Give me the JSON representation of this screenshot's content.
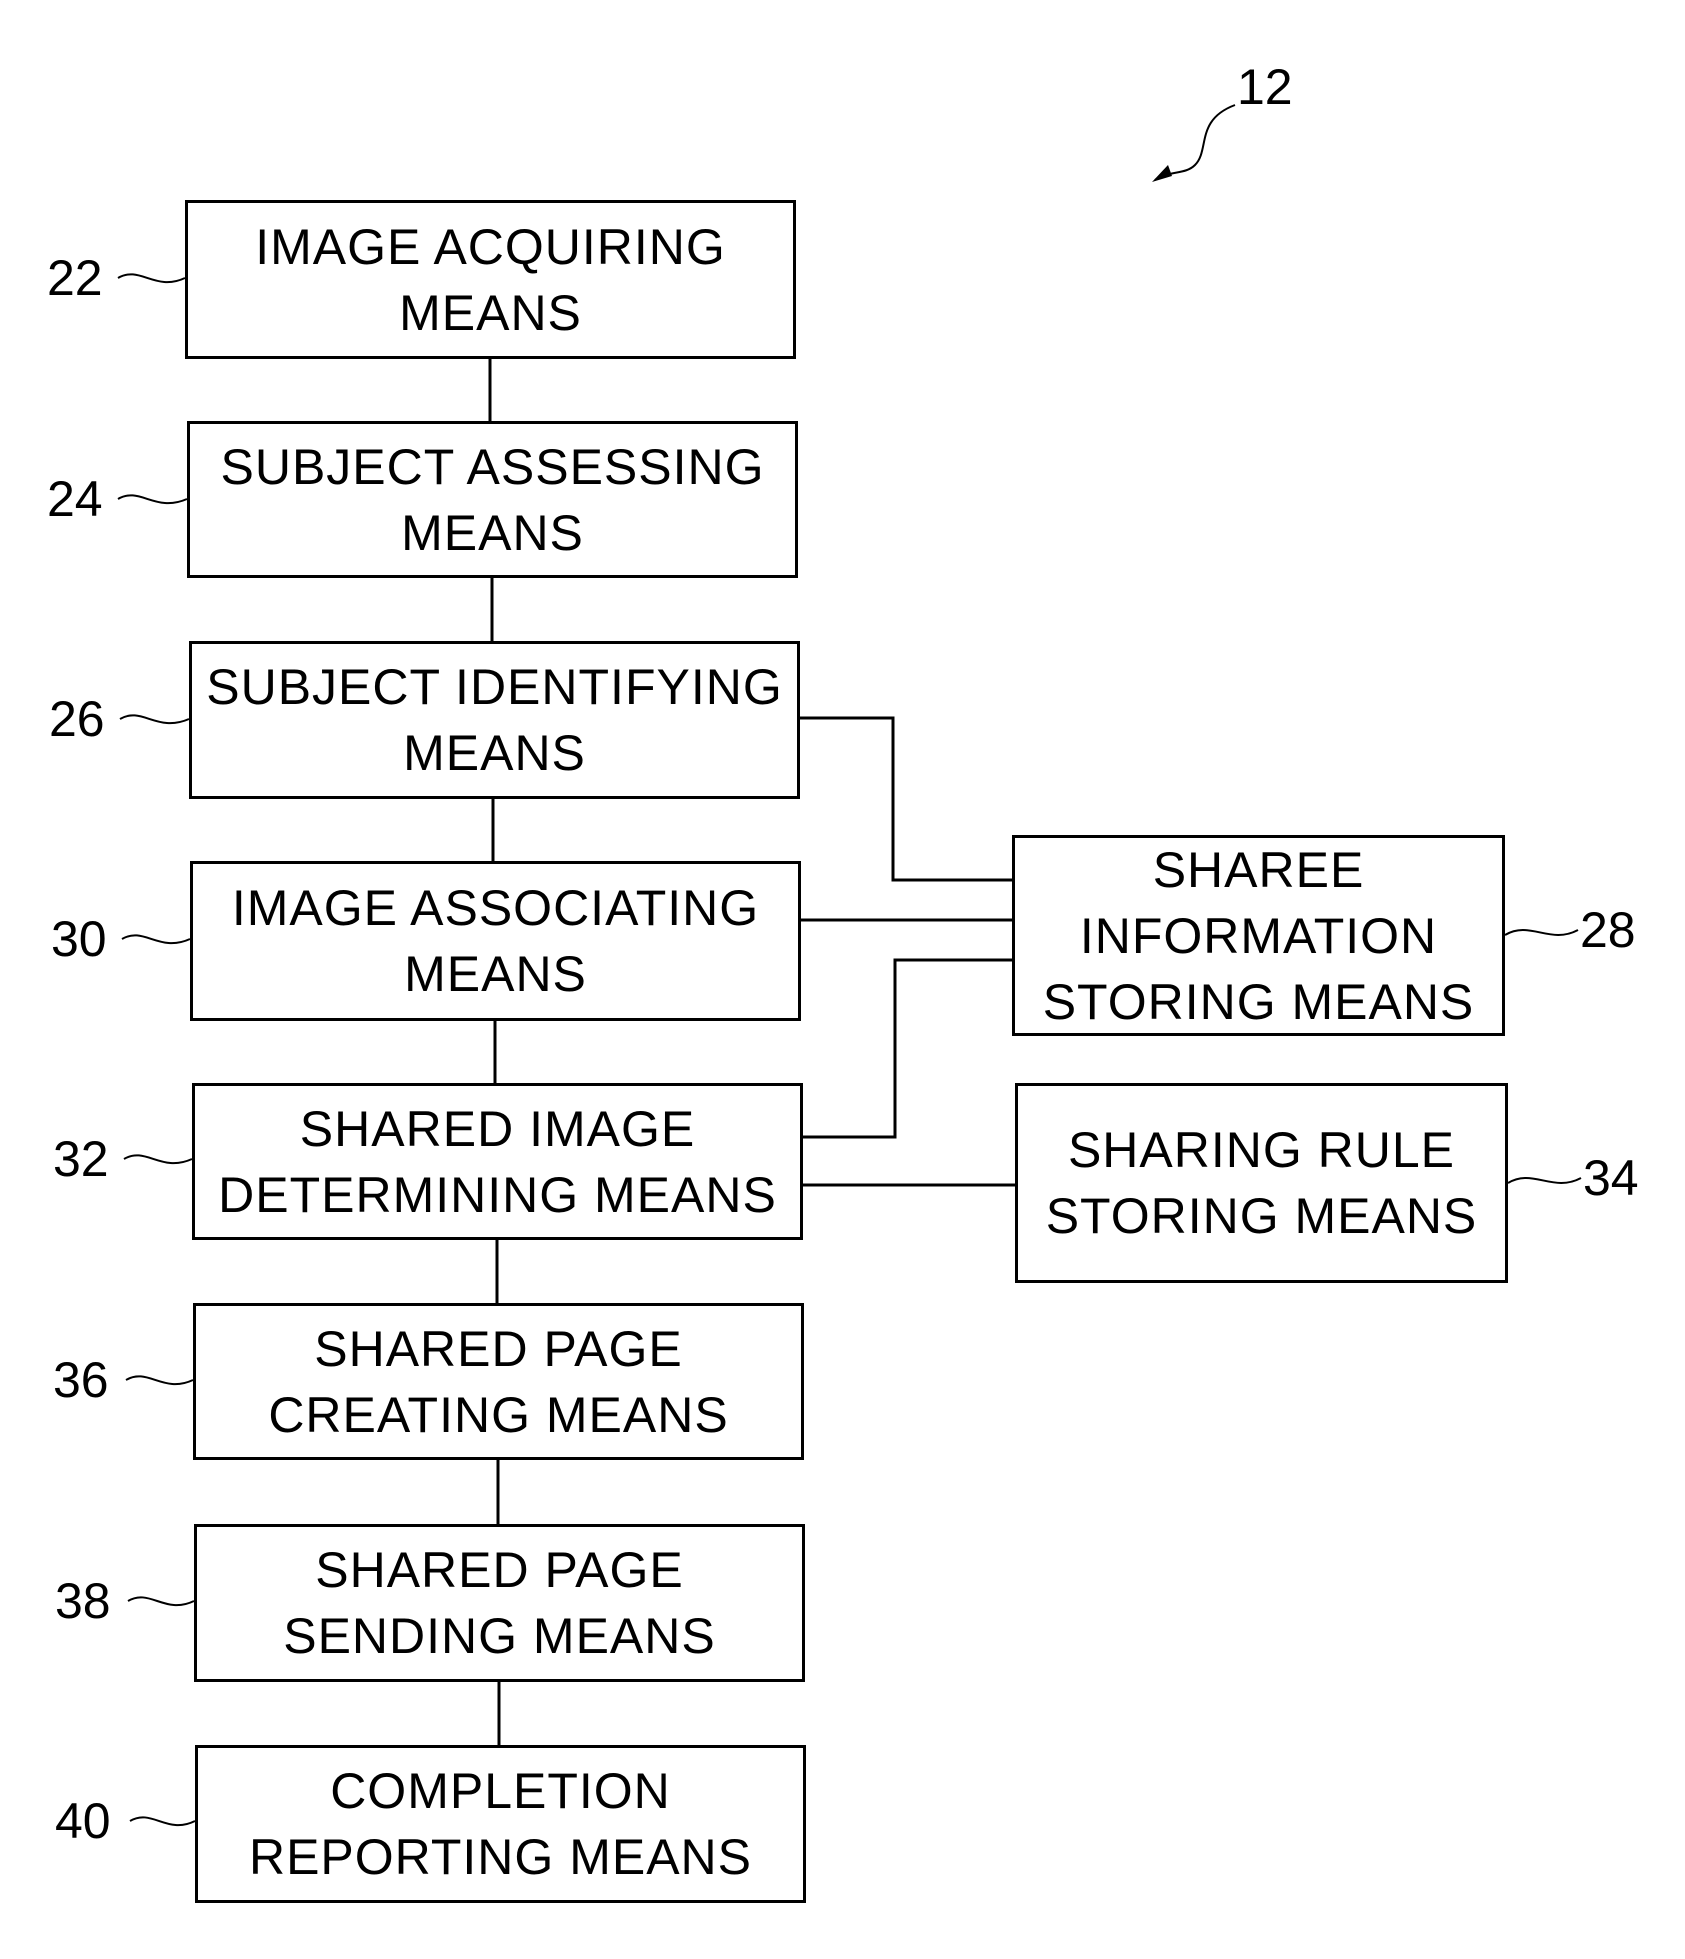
{
  "figure_ref": "12",
  "blocks": [
    {
      "id": "22",
      "lines": [
        "IMAGE ACQUIRING",
        "MEANS"
      ]
    },
    {
      "id": "24",
      "lines": [
        "SUBJECT ASSESSING",
        "MEANS"
      ]
    },
    {
      "id": "26",
      "lines": [
        "SUBJECT IDENTIFYING",
        "MEANS"
      ]
    },
    {
      "id": "30",
      "lines": [
        "IMAGE ASSOCIATING",
        "MEANS"
      ]
    },
    {
      "id": "32",
      "lines": [
        "SHARED IMAGE",
        "DETERMINING MEANS"
      ]
    },
    {
      "id": "36",
      "lines": [
        "SHARED PAGE",
        "CREATING MEANS"
      ]
    },
    {
      "id": "38",
      "lines": [
        "SHARED PAGE",
        "SENDING MEANS"
      ]
    },
    {
      "id": "40",
      "lines": [
        "COMPLETION",
        "REPORTING MEANS"
      ]
    },
    {
      "id": "28",
      "lines": [
        "SHAREE",
        "INFORMATION",
        "STORING MEANS"
      ]
    },
    {
      "id": "34",
      "lines": [
        "SHARING RULE",
        "STORING MEANS"
      ]
    }
  ],
  "connections": [
    [
      "22",
      "24"
    ],
    [
      "24",
      "26"
    ],
    [
      "26",
      "30"
    ],
    [
      "30",
      "32"
    ],
    [
      "32",
      "36"
    ],
    [
      "36",
      "38"
    ],
    [
      "38",
      "40"
    ],
    [
      "26",
      "28"
    ],
    [
      "30",
      "28"
    ],
    [
      "32",
      "28"
    ],
    [
      "32",
      "34"
    ]
  ]
}
